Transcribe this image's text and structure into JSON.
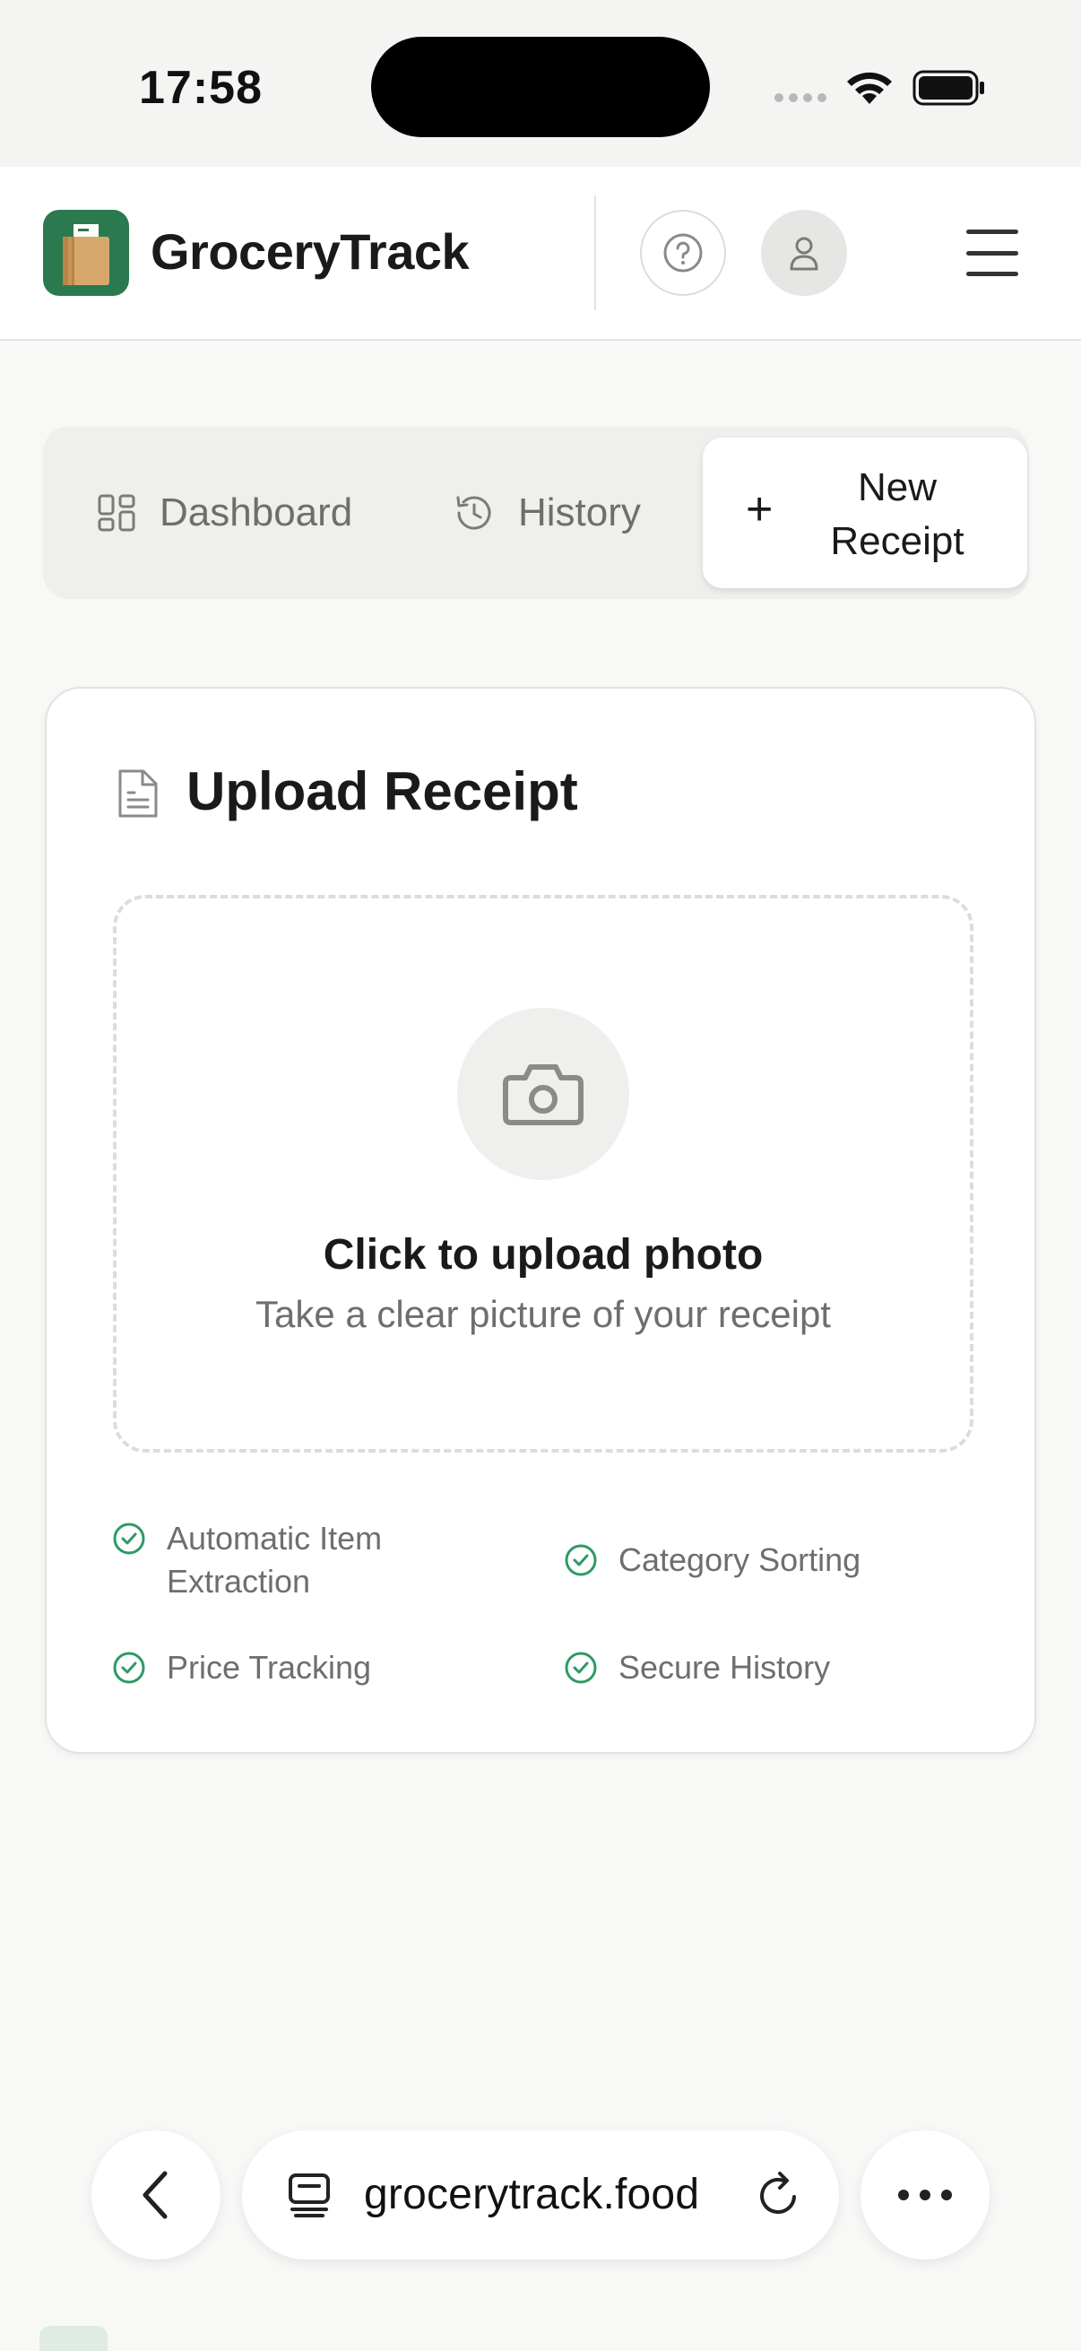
{
  "status_bar": {
    "time": "17:58"
  },
  "header": {
    "brand": "GroceryTrack",
    "colors": {
      "brand_green": "#2b7a4f"
    }
  },
  "tabs": [
    {
      "label": "Dashboard",
      "icon": "dashboard-grid-icon"
    },
    {
      "label": "History",
      "icon": "history-clock-icon"
    },
    {
      "label": "New Receipt",
      "icon": "plus-icon",
      "active": true
    }
  ],
  "upload_card": {
    "title": "Upload Receipt",
    "dropzone_title": "Click to upload photo",
    "dropzone_subtitle": "Take a clear picture of your receipt",
    "features": [
      "Automatic Item Extraction",
      "Category Sorting",
      "Price Tracking",
      "Secure History"
    ],
    "colors": {
      "check_green": "#2e9a63"
    }
  },
  "browser": {
    "url": "grocerytrack.food"
  }
}
